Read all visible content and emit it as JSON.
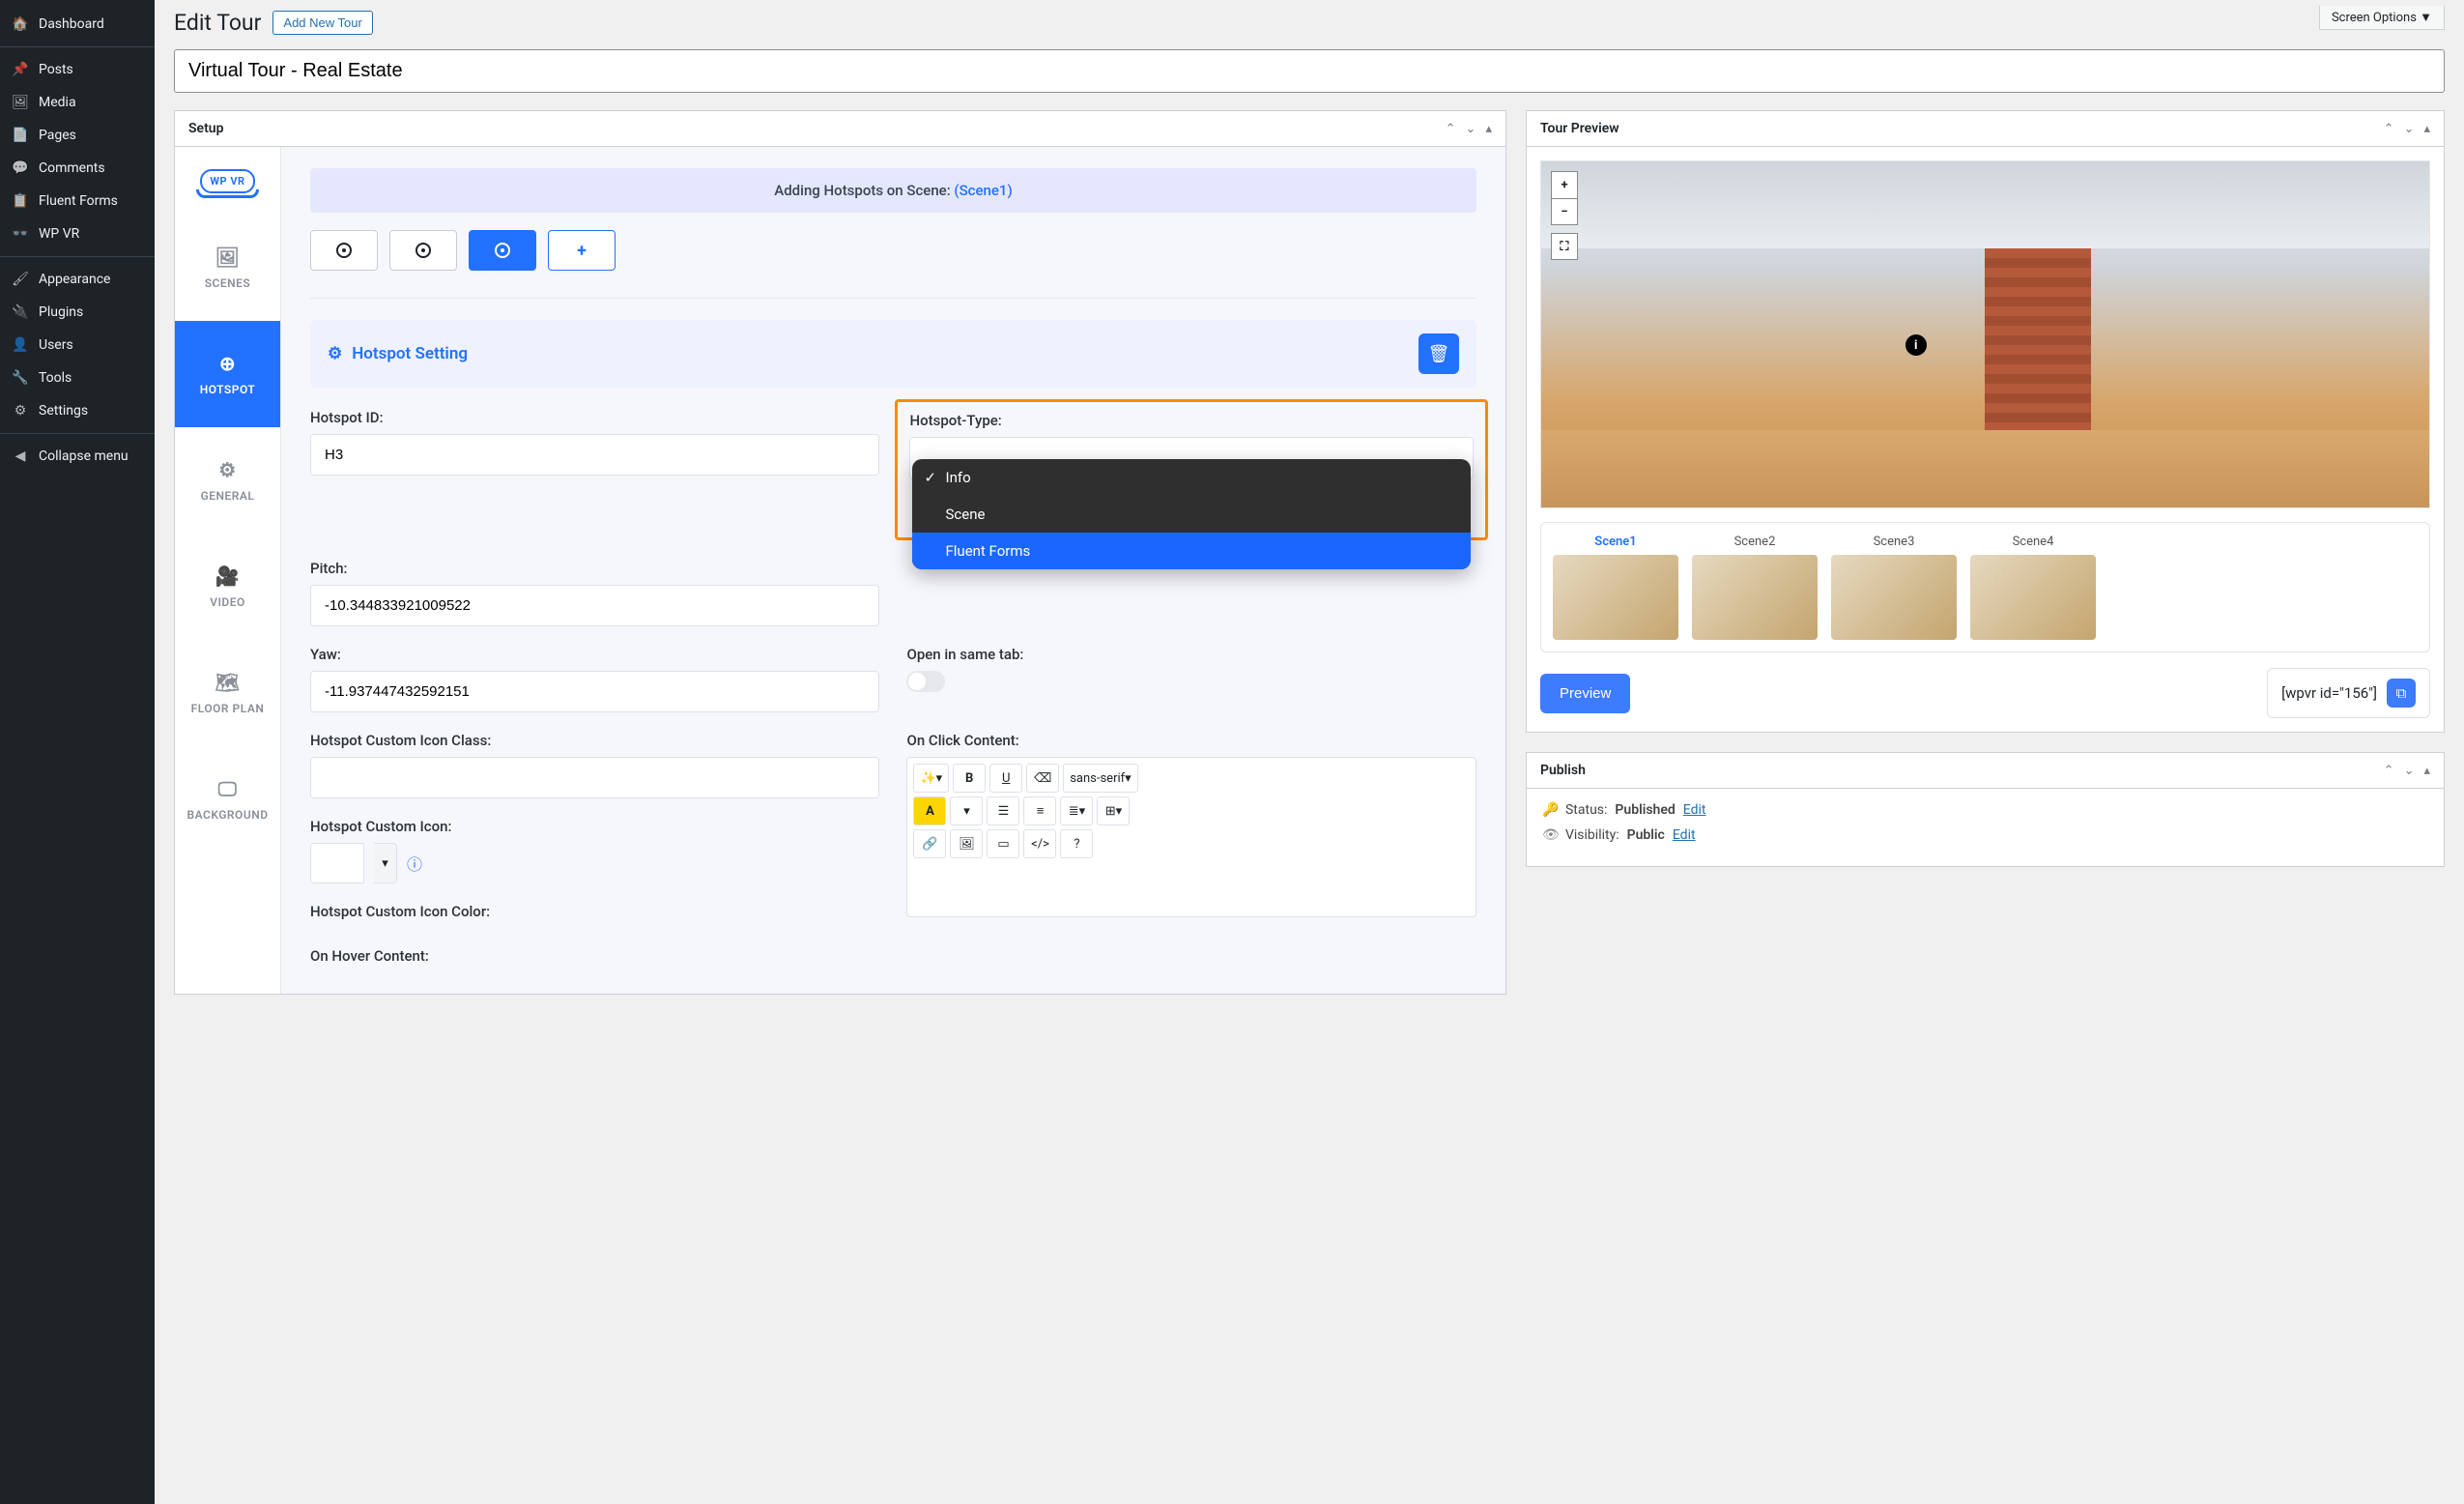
{
  "sidebar": {
    "items": [
      {
        "label": "Dashboard",
        "icon": "🏠"
      },
      {
        "label": "Posts",
        "icon": "📌"
      },
      {
        "label": "Media",
        "icon": "🖼"
      },
      {
        "label": "Pages",
        "icon": "📄"
      },
      {
        "label": "Comments",
        "icon": "💬"
      },
      {
        "label": "Fluent Forms",
        "icon": "📋"
      },
      {
        "label": "WP VR",
        "icon": "👓"
      },
      {
        "label": "Appearance",
        "icon": "🖌"
      },
      {
        "label": "Plugins",
        "icon": "🔌"
      },
      {
        "label": "Users",
        "icon": "👤"
      },
      {
        "label": "Tools",
        "icon": "🔧"
      },
      {
        "label": "Settings",
        "icon": "⚙"
      },
      {
        "label": "Collapse menu",
        "icon": "◀"
      }
    ]
  },
  "header": {
    "title": "Edit Tour",
    "add_new": "Add New Tour",
    "screen_options": "Screen Options"
  },
  "tour_title": "Virtual Tour - Real Estate",
  "setup": {
    "panel_title": "Setup",
    "tabs": [
      {
        "label": "WP VR",
        "type": "logo"
      },
      {
        "label": "SCENES",
        "icon": "🖼"
      },
      {
        "label": "HOTSPOT",
        "icon": "⊕",
        "active": true
      },
      {
        "label": "GENERAL",
        "icon": "⚙"
      },
      {
        "label": "VIDEO",
        "icon": "🎥"
      },
      {
        "label": "FLOOR PLAN",
        "icon": "🗺"
      },
      {
        "label": "BACKGROUND",
        "icon": "🖵"
      }
    ],
    "banner_prefix": "Adding Hotspots on Scene: ",
    "banner_link": "(Scene1)",
    "setting_title": "Hotspot Setting",
    "fields": {
      "hotspot_id_label": "Hotspot ID:",
      "hotspot_id_value": "H3",
      "hotspot_type_label": "Hotspot-Type:",
      "hotspot_type_options": [
        "Info",
        "Scene",
        "Fluent Forms"
      ],
      "pitch_label": "Pitch:",
      "pitch_value": "-10.344833921009522",
      "yaw_label": "Yaw:",
      "yaw_value": "-11.937447432592151",
      "open_tab_label": "Open in same tab:",
      "onclick_label": "On Click Content:",
      "onhover_label": "On Hover Content:",
      "custom_icon_class_label": "Hotspot Custom Icon Class:",
      "custom_icon_label": "Hotspot Custom Icon:",
      "custom_icon_color_label": "Hotspot Custom Icon Color:",
      "font_family": "sans-serif"
    }
  },
  "preview": {
    "panel_title": "Tour Preview",
    "scenes": [
      "Scene1",
      "Scene2",
      "Scene3",
      "Scene4"
    ],
    "preview_btn": "Preview",
    "shortcode": "[wpvr id=\"156\"]"
  },
  "publish": {
    "panel_title": "Publish",
    "status_label": "Status:",
    "status_value": "Published",
    "visibility_label": "Visibility:",
    "visibility_value": "Public",
    "edit_link": "Edit"
  }
}
